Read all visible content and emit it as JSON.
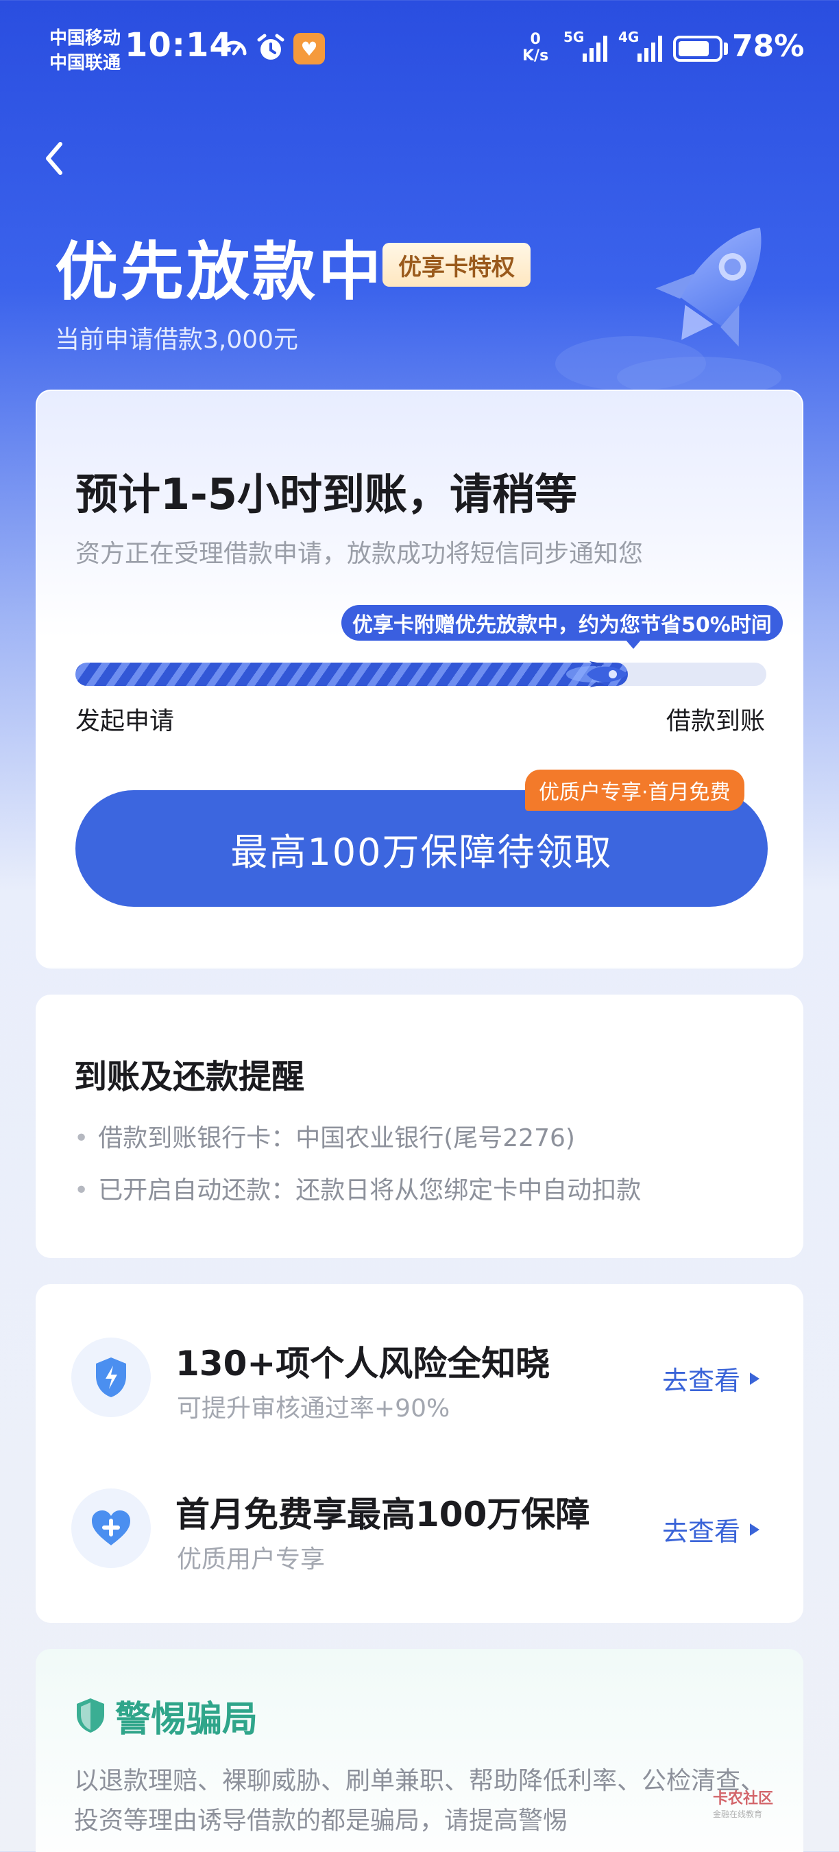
{
  "status_bar": {
    "carrier_1": "中国移动",
    "carrier_2": "中国联通",
    "time": "10:14",
    "net_speed_value": "0",
    "net_speed_unit": "K/s",
    "network_1": "5G",
    "network_2": "4G",
    "battery_percent": "78%",
    "battery_level": 0.78
  },
  "header": {
    "title": "优先放款中",
    "tag": "优享卡特权",
    "subtitle": "当前申请借款3,000元"
  },
  "status_card": {
    "title": "预计1-5小时到账，请稍等",
    "description": "资方正在受理借款申请，放款成功将短信同步通知您",
    "progress_tip": "优享卡附赠优先放款中，约为您节省50%时间",
    "progress_fraction": 0.8,
    "step_start": "发起申请",
    "step_end": "借款到账",
    "cta_label": "最高100万保障待领取",
    "cta_tag": "优质户专享·首月免费"
  },
  "reminder_card": {
    "title": "到账及还款提醒",
    "items": [
      "借款到账银行卡：中国农业银行(尾号2276)",
      "已开启自动还款：还款日将从您绑定卡中自动扣款"
    ]
  },
  "services": [
    {
      "icon": "lightning-shield-icon",
      "title": "130+项个人风险全知晓",
      "subtitle": "可提升审核通过率+90%",
      "link": "去查看"
    },
    {
      "icon": "heart-plus-icon",
      "title": "首月免费享最高100万保障",
      "subtitle": "优质用户专享",
      "link": "去查看"
    }
  ],
  "warning_card": {
    "title": "警惕骗局",
    "text": "以退款理赔、裸聊威胁、刷单兼职、帮助降低利率、公检清查、投资等理由诱导借款的都是骗局，请提高警惕"
  },
  "watermark": {
    "name": "卡农社区",
    "tagline": "金融在线教育"
  },
  "colors": {
    "brand_blue": "#3c66df",
    "tag_orange": "#f37a2a",
    "warning_green": "#2fa58a"
  }
}
